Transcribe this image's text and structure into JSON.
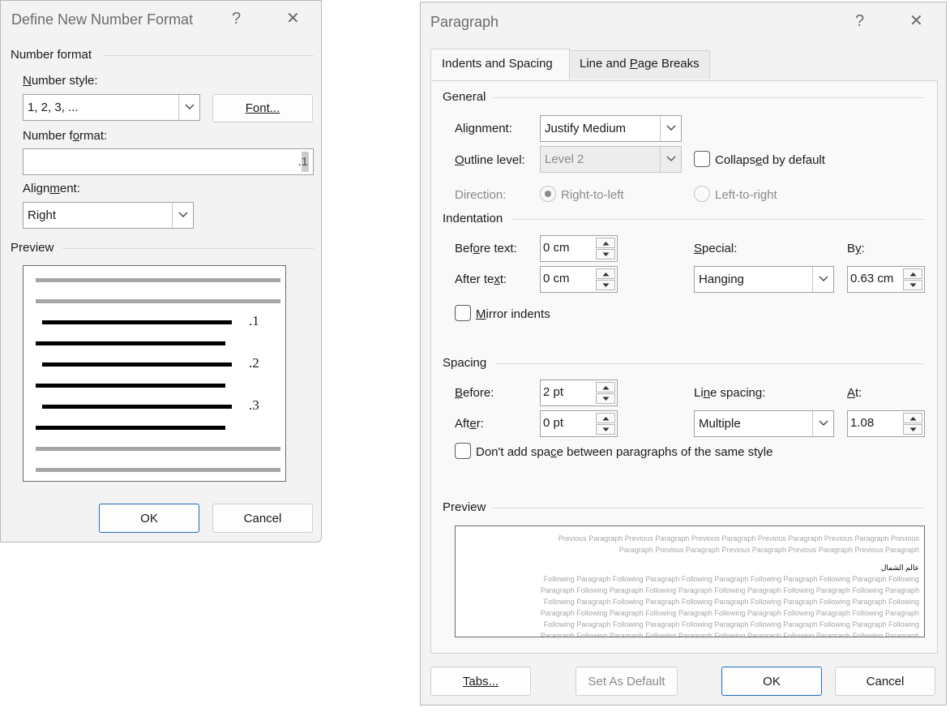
{
  "dialog1": {
    "title": "Define New Number Format",
    "help_glyph": "?",
    "close_glyph": "✕",
    "number_format_section": "Number format",
    "number_style_label": "Number style:",
    "number_style_value": "1, 2, 3, ...",
    "font_button": "Font...",
    "number_format_label": "Number format:",
    "number_format_value": ".1",
    "alignment_label": "Alignment:",
    "alignment_value": "Right",
    "preview_section": "Preview",
    "preview_numbers": [
      ".1",
      ".2",
      ".3"
    ],
    "ok": "OK",
    "cancel": "Cancel"
  },
  "dialog2": {
    "title": "Paragraph",
    "help_glyph": "?",
    "close_glyph": "✕",
    "tabs": [
      "Indents and Spacing",
      "Line and Page Breaks"
    ],
    "general_section": "General",
    "alignment_label": "Alignment:",
    "alignment_value": "Justify Medium",
    "outline_level_label": "Outline level:",
    "outline_level_value": "Level 2",
    "collapsed_label": "Collapsed by default",
    "direction_label": "Direction:",
    "rtl_label": "Right-to-left",
    "ltr_label": "Left-to-right",
    "indentation_section": "Indentation",
    "before_text_label": "Before text:",
    "before_text_value": "0 cm",
    "after_text_label": "After text:",
    "after_text_value": "0 cm",
    "special_label": "Special:",
    "special_value": "Hanging",
    "by_label": "By:",
    "by_value": "0.63 cm",
    "mirror_label": "Mirror indents",
    "spacing_section": "Spacing",
    "before_label": "Before:",
    "before_value": "2 pt",
    "after_label": "After:",
    "after_value": "0 pt",
    "line_spacing_label": "Line spacing:",
    "line_spacing_value": "Multiple",
    "at_label": "At:",
    "at_value": "1.08",
    "dont_add_label": "Don't add space between paragraphs of the same style",
    "preview_section": "Preview",
    "preview_previous": "Previous Paragraph Previous Paragraph Previous Paragraph Previous Paragraph Previous Paragraph Previous Paragraph Previous Paragraph Previous Paragraph Previous Paragraph Previous Paragraph",
    "preview_sample": "عالم الشمال",
    "preview_following": "Following Paragraph Following Paragraph Following Paragraph Following Paragraph Following Paragraph Following Paragraph Following Paragraph Following Paragraph Following Paragraph Following Paragraph Following Paragraph Following Paragraph Following Paragraph Following Paragraph Following Paragraph Following Paragraph Following Paragraph Following Paragraph Following Paragraph Following Paragraph Following Paragraph Following Paragraph Following Paragraph Following Paragraph Following Paragraph Following Paragraph Following Paragraph Following Paragraph Following Paragraph Following Paragraph Following Paragraph Following Paragraph Following Paragraph Following Paragraph Following Paragraph Following Paragraph Following Paragraph Following Paragraph Following Paragraph Following Paragraph",
    "tabs_button": "Tabs...",
    "set_default_button": "Set As Default",
    "ok": "OK",
    "cancel": "Cancel"
  }
}
